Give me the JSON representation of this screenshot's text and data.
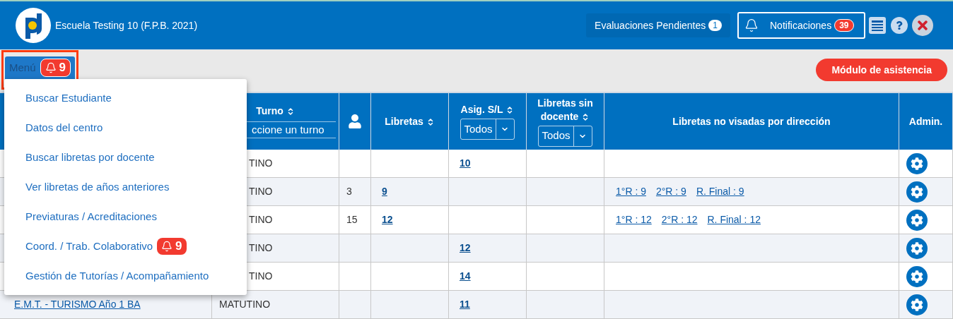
{
  "header": {
    "school": "Escuela Testing 10 (F.P.B. 2021)",
    "pending": {
      "label": "Evaluaciones Pendientes",
      "count": "1"
    },
    "notifications": {
      "label": "Notificaciones",
      "count": "39"
    }
  },
  "toolbar": {
    "menu": {
      "label": "Menú",
      "count": "9",
      "expanded": true
    },
    "attendance": "Módulo de asistencia"
  },
  "menu_items": [
    {
      "label": "Buscar Estudiante"
    },
    {
      "label": "Datos del centro"
    },
    {
      "label": "Buscar libretas por docente"
    },
    {
      "label": "Ver libretas de años anteriores"
    },
    {
      "label": "Previaturas / Acreditaciones"
    },
    {
      "label": "Coord. / Trab. Colaborativo",
      "count": "9"
    },
    {
      "label": "Gestión de Tutorías / Acompañamiento"
    }
  ],
  "table": {
    "columns": [
      {
        "kind": "text",
        "label": "Turno",
        "sortable": true,
        "filter": "ccione un turno"
      },
      {
        "kind": "icon"
      },
      {
        "kind": "text",
        "label": "Libretas",
        "sortable": true
      },
      {
        "kind": "text",
        "label": "Asig. S/L",
        "sortable": true,
        "select": "Todos"
      },
      {
        "kind": "text",
        "label": "Libretas sin docente",
        "sortable": true,
        "select": "Todos"
      },
      {
        "kind": "text",
        "label": "Libretas no visadas por dirección",
        "sortable": false
      },
      {
        "kind": "text",
        "label": "Admin.",
        "sortable": false
      }
    ],
    "rows": [
      {
        "turno": "TINO",
        "asig": "10"
      },
      {
        "turno": "TINO",
        "students": "3",
        "libretas": "9",
        "visadas": [
          "1°R : 9",
          "2°R : 9",
          "R. Final : 9"
        ]
      },
      {
        "turno": "TINO",
        "students": "15",
        "libretas": "12",
        "visadas": [
          "1°R : 12",
          "2°R : 12",
          "R. Final : 12"
        ]
      },
      {
        "turno": "TINO",
        "asig": "12"
      },
      {
        "turno": "TINO",
        "asig": "14"
      },
      {
        "name": "E.M.T. - TURISMO Año 1 BA",
        "turno": "MATUTINO",
        "asig": "11"
      }
    ]
  }
}
